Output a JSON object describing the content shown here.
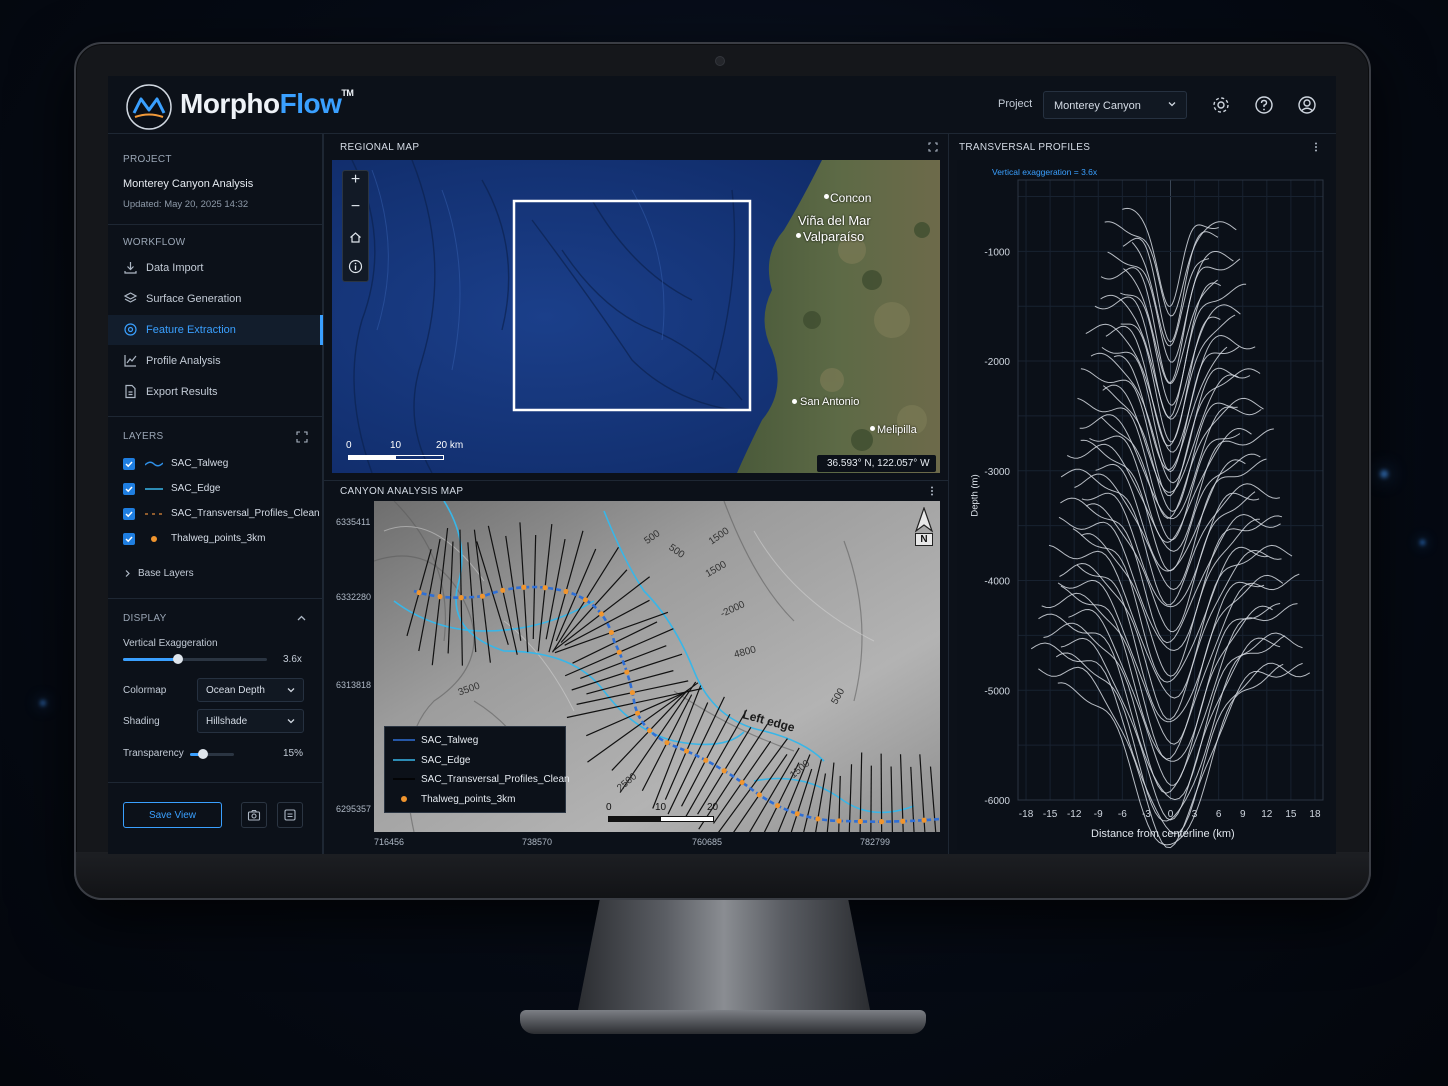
{
  "app": {
    "name_a": "Morpho",
    "name_b": "Flow",
    "tm": "TM"
  },
  "header": {
    "project_label": "Project",
    "project_value": "Monterey Canyon"
  },
  "sidebar": {
    "project_heading": "PROJECT",
    "project_name": "Monterey Canyon Analysis",
    "updated": "Updated: May 20, 2025  14:32",
    "workflow_heading": "WORKFLOW",
    "workflow": [
      {
        "label": "Data Import",
        "icon": "download-icon"
      },
      {
        "label": "Surface Generation",
        "icon": "layers-icon"
      },
      {
        "label": "Feature Extraction",
        "icon": "target-icon",
        "active": true
      },
      {
        "label": "Profile Analysis",
        "icon": "chart-line-icon"
      },
      {
        "label": "Export Results",
        "icon": "file-export-icon"
      }
    ],
    "layers_heading": "LAYERS",
    "layers": [
      {
        "label": "SAC_Talweg",
        "checked": true
      },
      {
        "label": "SAC_Edge",
        "checked": true
      },
      {
        "label": "SAC_Transversal_Profiles_Clean",
        "checked": true
      },
      {
        "label": "Thalweg_points_3km",
        "checked": true
      }
    ],
    "base_layers": "Base Layers",
    "display_heading": "DISPLAY",
    "vertical_exaggeration_label": "Vertical Exaggeration",
    "vertical_exaggeration_value": "3.6x",
    "vertical_exaggeration_fraction": 0.38,
    "colormap_label": "Colormap",
    "colormap_value": "Ocean Depth",
    "shading_label": "Shading",
    "shading_value": "Hillshade",
    "transparency_label": "Transparency",
    "transparency_value": "15%",
    "transparency_fraction": 0.15,
    "save_view": "Save View"
  },
  "regional_map": {
    "title": "REGIONAL MAP",
    "places": [
      "Concon",
      "Viña del Mar",
      "Valparaíso",
      "San Antonio",
      "Melipilla"
    ],
    "scale": [
      "0",
      "10",
      "20 km"
    ],
    "coords": "36.593° N, 122.057° W"
  },
  "canyon_map": {
    "title": "CANYON ANALYSIS MAP",
    "y_ticks": [
      "6335411",
      "6332280",
      "6313818",
      "6295357"
    ],
    "x_ticks": [
      "716456",
      "738570",
      "760685",
      "782799"
    ],
    "contours": [
      "500",
      "500",
      "1500",
      "1500",
      "-2000",
      "4800",
      "500",
      "3500",
      "2500",
      "1500"
    ],
    "edge_label": "Left edge",
    "north": "N",
    "scale": [
      "0",
      "10",
      "20"
    ],
    "legend": [
      "SAC_Talweg",
      "SAC_Edge",
      "SAC_Transversal_Profiles_Clean",
      "Thalweg_points_3km"
    ]
  },
  "profiles": {
    "title": "TRANSVERSAL PROFILES",
    "subtitle": "Vertical exaggeration = 3.6x",
    "chart_data": {
      "type": "line",
      "xlabel": "Distance from centerline (km)",
      "ylabel": "Depth (m)",
      "x_ticks": [
        "-18",
        "-15",
        "-12",
        "-9",
        "-6",
        "-3",
        "0",
        "3",
        "6",
        "9",
        "12",
        "15",
        "18"
      ],
      "y_ticks": [
        "-1000",
        "-2000",
        "-3000",
        "-4000",
        "-5000",
        "-6000"
      ],
      "xlim": [
        -19,
        19
      ],
      "ylim": [
        -6000,
        -350
      ],
      "profile_count": 48
    }
  },
  "colors": {
    "accent": "#3aa0ff",
    "bg": "#0c1119",
    "panel_border": "#1e2733"
  }
}
